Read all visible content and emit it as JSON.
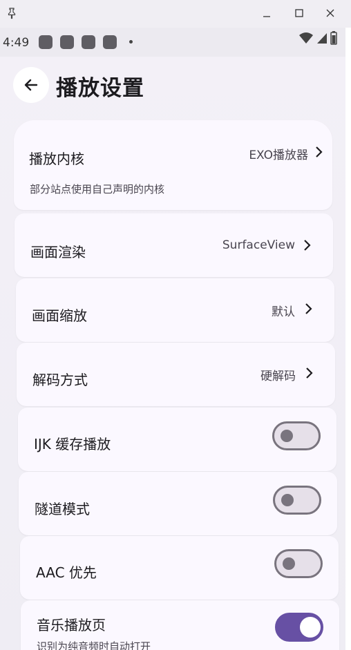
{
  "status": {
    "time": "4:49"
  },
  "header": {
    "title": "播放设置"
  },
  "settings": [
    {
      "label": "播放内核",
      "value": "EXO播放器",
      "description": "部分站点使用自己声明的内核"
    },
    {
      "label": "画面渲染",
      "value": "SurfaceView"
    },
    {
      "label": "画面缩放",
      "value": "默认"
    },
    {
      "label": "解码方式",
      "value": "硬解码"
    },
    {
      "label": "IJK 缓存播放",
      "toggle": "off"
    },
    {
      "label": "隧道模式",
      "toggle": "off"
    },
    {
      "label": "AAC 优先",
      "toggle": "off"
    },
    {
      "label": "音乐播放页",
      "description": "识别为纯音频时自动打开",
      "toggle": "on"
    }
  ],
  "colors": {
    "accent": "#6750a4",
    "card": "#fbf8ff",
    "background": "#efedf4"
  },
  "icons": [
    "pin-icon",
    "minimize-icon",
    "maximize-icon",
    "close-icon",
    "wifi-icon",
    "signal-icon",
    "battery-icon",
    "back-arrow-icon",
    "chevron-right-icon"
  ]
}
